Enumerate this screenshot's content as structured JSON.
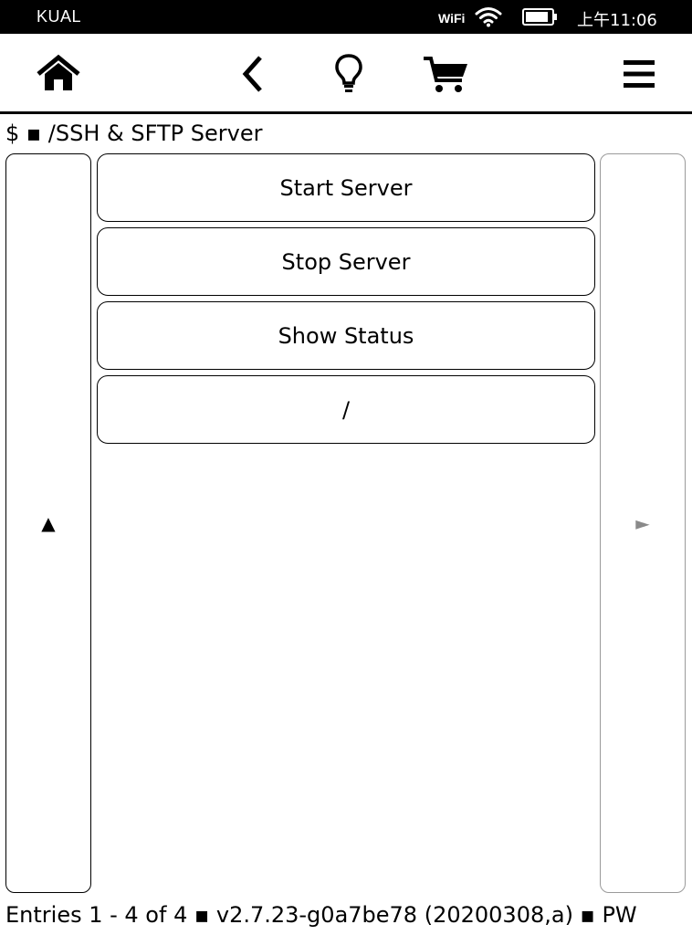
{
  "status_bar": {
    "app_name": "KUAL",
    "wifi_label": "WiFi",
    "wifi_icon": "wifi-icon",
    "battery_icon": "battery-icon",
    "time": "上午11:06"
  },
  "toolbar": {
    "items": [
      {
        "name": "home",
        "icon": "home-icon"
      },
      {
        "name": "back",
        "icon": "chevron-left-icon"
      },
      {
        "name": "light",
        "icon": "lightbulb-icon"
      },
      {
        "name": "store",
        "icon": "cart-icon"
      },
      {
        "name": "menu",
        "icon": "hamburger-menu-icon"
      }
    ]
  },
  "breadcrumb": "$ ▪ /SSH & SFTP Server",
  "nav": {
    "up_arrow": "▲",
    "next_arrow": "►"
  },
  "menu": {
    "items": [
      {
        "label": "Start Server"
      },
      {
        "label": "Stop Server"
      },
      {
        "label": "Show Status"
      },
      {
        "label": "/"
      }
    ]
  },
  "footer": "Entries 1 - 4 of 4 ▪ v2.7.23-g0a7be78 (20200308,a) ▪ PW"
}
